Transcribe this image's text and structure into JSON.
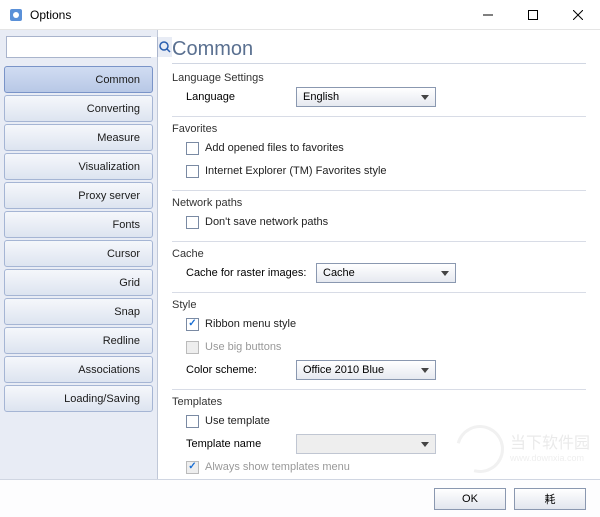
{
  "window": {
    "title": "Options"
  },
  "search": {
    "placeholder": ""
  },
  "sidebar": {
    "items": [
      {
        "label": "Common",
        "active": true
      },
      {
        "label": "Converting"
      },
      {
        "label": "Measure"
      },
      {
        "label": "Visualization"
      },
      {
        "label": "Proxy server"
      },
      {
        "label": "Fonts"
      },
      {
        "label": "Cursor"
      },
      {
        "label": "Grid"
      },
      {
        "label": "Snap"
      },
      {
        "label": "Redline"
      },
      {
        "label": "Associations"
      },
      {
        "label": "Loading/Saving"
      }
    ]
  },
  "page": {
    "title": "Common",
    "groups": {
      "language": {
        "label": "Language Settings",
        "field": "Language",
        "value": "English"
      },
      "favorites": {
        "label": "Favorites",
        "opt1": "Add opened files to favorites",
        "opt2": "Internet Explorer (TM) Favorites style"
      },
      "network": {
        "label": "Network paths",
        "opt1": "Don't save network paths"
      },
      "cache": {
        "label": "Cache",
        "field": "Cache for raster images:",
        "value": "Cache"
      },
      "style": {
        "label": "Style",
        "opt1": "Ribbon menu style",
        "opt2": "Use big buttons",
        "field": "Color scheme:",
        "value": "Office 2010 Blue"
      },
      "templates": {
        "label": "Templates",
        "opt1": "Use template",
        "field": "Template name",
        "opt2": "Always show templates menu"
      }
    }
  },
  "footer": {
    "ok": "OK",
    "cancel": "耗"
  },
  "watermark": {
    "text": "当下软件园",
    "sub": "www.downxia.com"
  }
}
